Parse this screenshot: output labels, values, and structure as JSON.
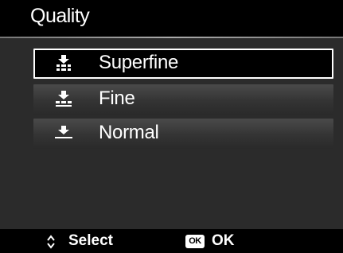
{
  "header": {
    "title": "Quality"
  },
  "menu": {
    "items": [
      {
        "label": "Superfine",
        "icon": "quality-superfine-icon",
        "selected": true
      },
      {
        "label": "Fine",
        "icon": "quality-fine-icon",
        "selected": false
      },
      {
        "label": "Normal",
        "icon": "quality-normal-icon",
        "selected": false
      }
    ]
  },
  "footer": {
    "select_icon": "up-down-arrows-icon",
    "select_label": "Select",
    "ok_icon_text": "OK",
    "ok_label": "OK"
  },
  "colors": {
    "background": "#000000",
    "panel": "#2b2b2b",
    "text": "#ffffff",
    "selection_border": "#ffffff"
  }
}
